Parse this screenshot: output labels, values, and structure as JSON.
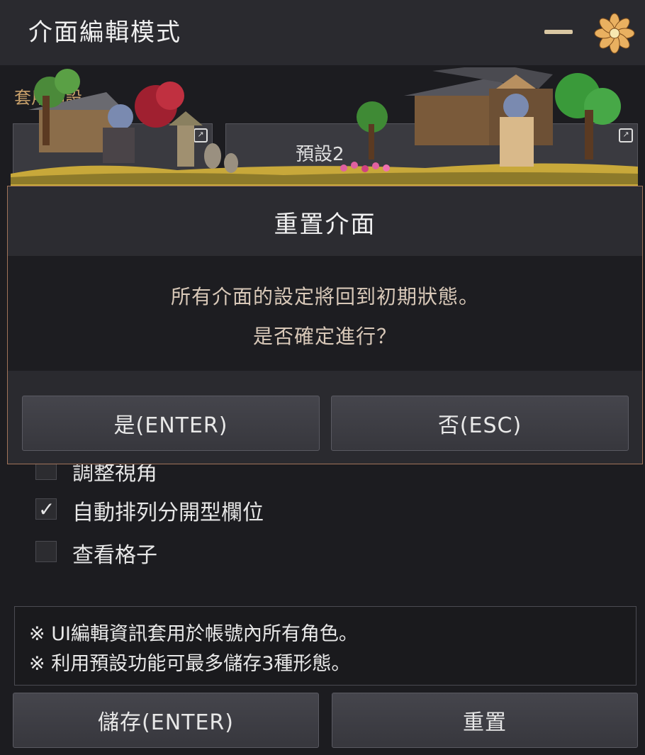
{
  "window": {
    "title": "介面編輯模式",
    "minimize_icon": "minimize-icon",
    "menu_icon": "flower-emblem-icon"
  },
  "presets": {
    "label": "套用預設",
    "preset_text": "預設2"
  },
  "options": [
    {
      "label": "調整視角",
      "checked": false
    },
    {
      "label": "自動排列分開型欄位",
      "checked": true
    },
    {
      "label": "查看格子",
      "checked": false
    }
  ],
  "info": {
    "line1": "※ UI編輯資訊套用於帳號內所有角色。",
    "line2": "※ 利用預設功能可最多儲存3種形態。"
  },
  "buttons": {
    "save": "儲存(ENTER)",
    "reset": "重置"
  },
  "dialog": {
    "title": "重置介面",
    "message_line1": "所有介面的設定將回到初期狀態。",
    "message_line2": "是否確定進行？",
    "yes": "是(ENTER)",
    "no": "否(ESC)"
  },
  "colors": {
    "accent_gold": "#d9c7a3",
    "dialog_border": "#a2745a"
  }
}
